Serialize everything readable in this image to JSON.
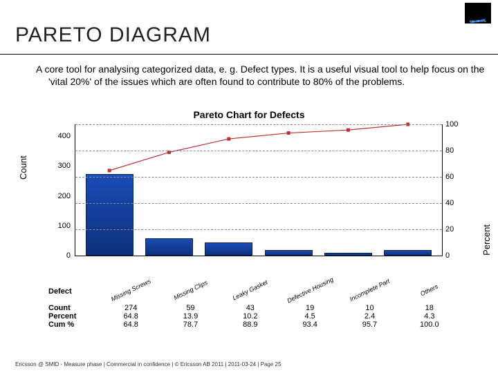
{
  "brand": {
    "name": "ERICSSON"
  },
  "title": "PARETO DIAGRAM",
  "description": "A core tool for analysing categorized data, e. g. Defect types. It is a useful visual tool to help focus on the 'vital 20%' of the issues which are often found to contribute to 80% of the problems.",
  "chart_data": {
    "type": "bar",
    "title": "Pareto Chart for Defects",
    "ylabel": "Count",
    "y2label": "Percent",
    "ylim": [
      0,
      440
    ],
    "y2lim": [
      0,
      100
    ],
    "yticks": [
      0,
      100,
      200,
      300,
      400
    ],
    "y2ticks": [
      0,
      20,
      40,
      60,
      80,
      100
    ],
    "row_headers": {
      "category": "Defect",
      "count": "Count",
      "percent": "Percent",
      "cum": "Cum %"
    },
    "categories": [
      {
        "label": "Missing Screws",
        "count": 274,
        "count_display": "274",
        "percent": "64.8",
        "cum": "64.8"
      },
      {
        "label": "Missing Clips",
        "count": 59,
        "count_display": "59",
        "percent": "13.9",
        "cum": "78.7"
      },
      {
        "label": "Leaky Gasket",
        "count": 43,
        "count_display": "43",
        "percent": "10.2",
        "cum": "88.9"
      },
      {
        "label": "Defective Housing",
        "count": 19,
        "count_display": "19",
        "percent": "4.5",
        "cum": "93.4"
      },
      {
        "label": "Incomplete Part",
        "count": 10,
        "count_display": "10",
        "percent": "2.4",
        "cum": "95.7"
      },
      {
        "label": "Others",
        "count": 18,
        "count_display": "18",
        "percent": "4.3",
        "cum": "100.0"
      }
    ],
    "cum_line": [
      64.8,
      78.7,
      88.9,
      93.4,
      95.7,
      100.0
    ]
  },
  "footer": "Ericsson @ SMID - Measure phase  |  Commercial in confidence  |  © Ericsson AB 2011  |  2011-03-24  |  Page 25"
}
